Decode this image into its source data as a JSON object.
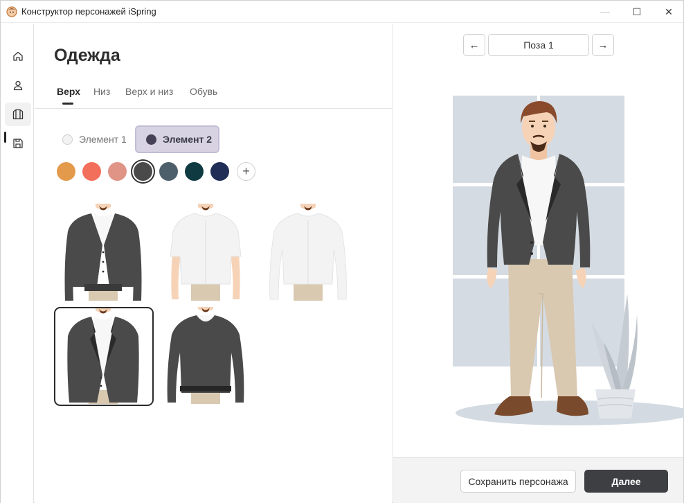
{
  "window": {
    "title": "Конструктор персонажей iSpring",
    "controls": {
      "minimize": "—",
      "maximize": "☐",
      "close": "✕"
    }
  },
  "rail": {
    "items": [
      {
        "icon": "home-icon"
      },
      {
        "icon": "person-icon"
      },
      {
        "icon": "clothing-icon",
        "active": true
      },
      {
        "icon": "save-icon"
      }
    ]
  },
  "main": {
    "title": "Одежда",
    "tabs": [
      {
        "label": "Верх",
        "active": true
      },
      {
        "label": "Низ"
      },
      {
        "label": "Верх и низ"
      },
      {
        "label": "Обувь"
      }
    ],
    "elements": [
      {
        "label": "Элемент 1",
        "selected": false
      },
      {
        "label": "Элемент 2",
        "selected": true
      }
    ],
    "swatches": [
      "#e39a4a",
      "#f26f5c",
      "#e09486",
      "#4a4a4a",
      "#4c5f6b",
      "#0f3a42",
      "#1f2d57"
    ],
    "selected_swatch_index": 3,
    "add_color_label": "+",
    "clothing_items": [
      {
        "name": "cardigan"
      },
      {
        "name": "short-sleeve-shirt"
      },
      {
        "name": "long-sleeve-shirt"
      },
      {
        "name": "blazer",
        "selected": true
      },
      {
        "name": "sweater"
      }
    ]
  },
  "preview": {
    "prev_icon": "←",
    "next_icon": "→",
    "pose_label": "Поза 1"
  },
  "footer": {
    "save_label": "Сохранить персонажа",
    "next_label": "Далее"
  }
}
